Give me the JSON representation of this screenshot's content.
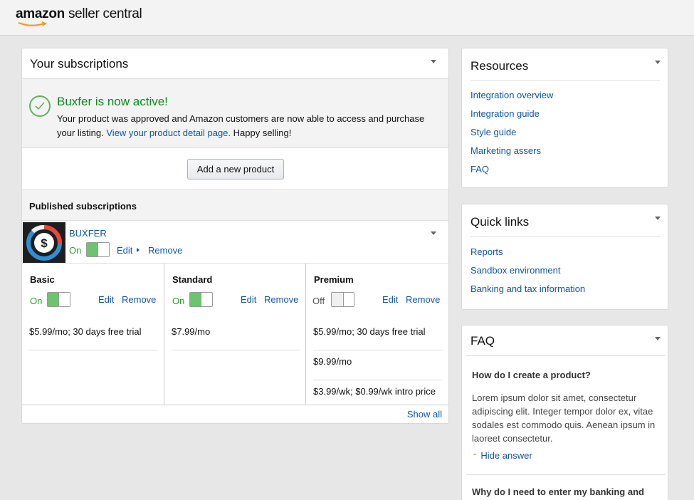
{
  "app": {
    "logo_brand": "amazon",
    "logo_product": "seller central"
  },
  "subscriptions": {
    "title": "Your subscriptions",
    "banner": {
      "title": "Buxfer is now active!",
      "text_before": "Your product was approved and Amazon customers are now able to access and purchase your listing. ",
      "link": "View your product detail page.",
      "text_after": " Happy selling!"
    },
    "add_button": "Add a new product",
    "published_label": "Published subscriptions",
    "product": {
      "name": "BUXFER",
      "state": "On",
      "edit": "Edit",
      "remove": "Remove",
      "logo_symbol": "$"
    },
    "tiers": [
      {
        "name": "Basic",
        "state": "On",
        "edit": "Edit",
        "remove": "Remove",
        "prices": [
          "$5.99/mo; 30 days free trial"
        ]
      },
      {
        "name": "Standard",
        "state": "On",
        "edit": "Edit",
        "remove": "Remove",
        "prices": [
          "$7.99/mo"
        ]
      },
      {
        "name": "Premium",
        "state": "Off",
        "edit": "Edit",
        "remove": "Remove",
        "prices": [
          "$5.99/mo; 30 days free trial",
          "$9.99/mo",
          "$3.99/wk; $0.99/wk intro price"
        ]
      }
    ],
    "show_all": "Show all"
  },
  "resources": {
    "title": "Resources",
    "links": [
      "Integration overview",
      "Integration guide",
      "Style guide",
      "Marketing assers",
      "FAQ"
    ]
  },
  "quick_links": {
    "title": "Quick links",
    "links": [
      "Reports",
      "Sandbox environment",
      "Banking and tax information"
    ]
  },
  "faq": {
    "title": "FAQ",
    "q1": "How do I create a product?",
    "a1": "Lorem ipsum dolor sit amet, consectetur adipiscing elit. Integer tempor dolor ex, vitae sodales est commodo quis. Aenean ipsum in laoreet consectetur.",
    "hide_answer": "Hide answer",
    "q2": "Why do I need to enter my banking and"
  },
  "colors": {
    "link": "#0f56a8",
    "success": "#0f8a1d",
    "toggle_on": "#6cc46c",
    "logo_smile": "#f39c12"
  },
  "icons": {
    "collapse": "caret-down-icon",
    "success": "check-circle-icon",
    "expand_link": "chevron-right-icon",
    "hide": "chevron-up-icon"
  }
}
